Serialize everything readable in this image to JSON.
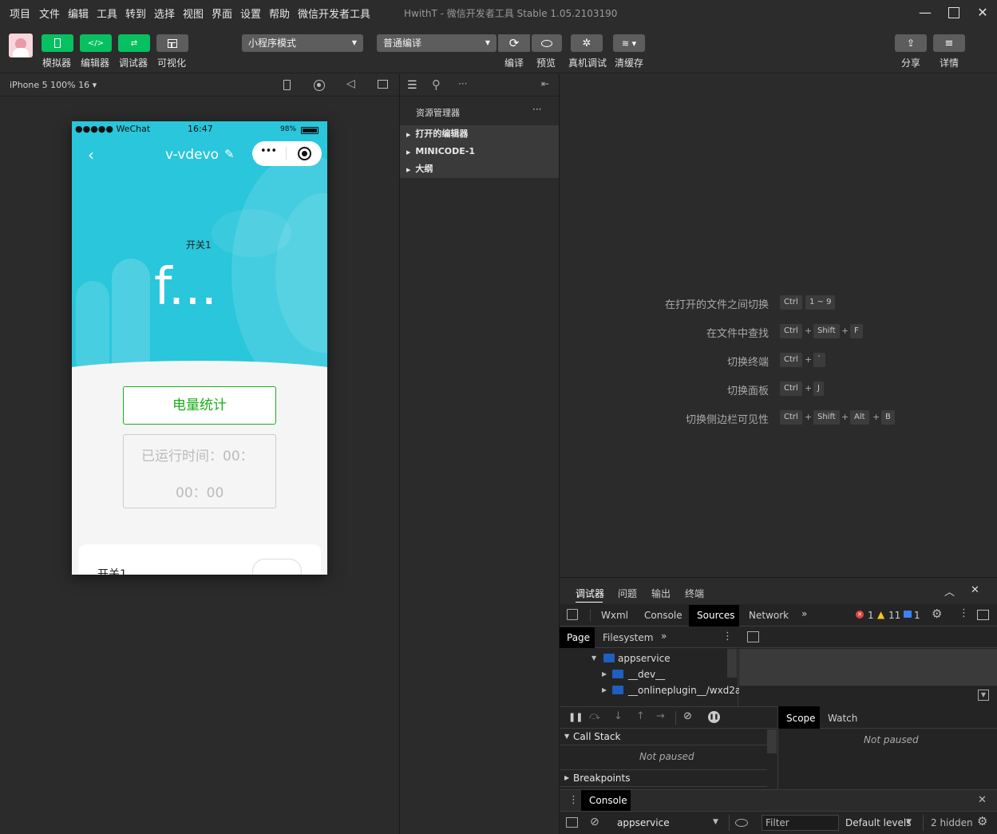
{
  "menu": [
    "项目",
    "文件",
    "编辑",
    "工具",
    "转到",
    "选择",
    "视图",
    "界面",
    "设置",
    "帮助",
    "微信开发者工具"
  ],
  "window_title": "HwithT - 微信开发者工具 Stable 1.05.2103190",
  "toolbar": {
    "simulator": "模拟器",
    "editor": "编辑器",
    "debugger": "调试器",
    "visual": "可视化",
    "mode_select": "小程序模式",
    "compile_select": "普通编译",
    "compile": "编译",
    "preview": "预览",
    "remote_debug": "真机调试",
    "clear_cache": "清缓存",
    "share": "分享",
    "details": "详情"
  },
  "sim_header": {
    "device": "iPhone 5 100% 16"
  },
  "phone": {
    "status_carrier": "●●●●● WeChat",
    "status_time": "16:47",
    "status_battery": "98%",
    "nav_title": "v-vdevo",
    "switch_label": "开关1",
    "big_text": "f...",
    "power_button": "电量统计",
    "runtime_line1": "已运行时间：00：",
    "runtime_line2": "00：00",
    "card_label": "开关1"
  },
  "explorer": {
    "title": "资源管理器",
    "rows": [
      "打开的编辑器",
      "MINICODE-1",
      "大纲"
    ]
  },
  "editor_hints": [
    {
      "label": "在打开的文件之间切换",
      "keys": [
        "Ctrl",
        "1 ~ 9"
      ]
    },
    {
      "label": "在文件中查找",
      "keys": [
        "Ctrl",
        "Shift",
        "F"
      ]
    },
    {
      "label": "切换终端",
      "keys": [
        "Ctrl",
        "`"
      ]
    },
    {
      "label": "切换面板",
      "keys": [
        "Ctrl",
        "J"
      ]
    },
    {
      "label": "切换侧边栏可见性",
      "keys": [
        "Ctrl",
        "Shift",
        "Alt",
        "B"
      ]
    }
  ],
  "devtools": {
    "top_tabs": [
      "调试器",
      "问题",
      "输出",
      "终端"
    ],
    "panel_tabs": [
      "Wxml",
      "Console",
      "Sources",
      "Network"
    ],
    "errors": "1",
    "warnings": "11",
    "infos": "1",
    "source_tabs": [
      "Page",
      "Filesystem"
    ],
    "tree": [
      "appservice",
      "__dev__",
      "__onlineplugin__/wxd2a"
    ],
    "scope_tab": "Scope",
    "watch_tab": "Watch",
    "call_stack": "Call Stack",
    "not_paused": "Not paused",
    "breakpoints": "Breakpoints",
    "console_tab": "Console",
    "context": "appservice",
    "filter_placeholder": "Filter",
    "levels": "Default levels",
    "hidden": "2 hidden"
  },
  "colors": {
    "accent_green": "#07c160",
    "phone_header": "#29c6dc"
  }
}
